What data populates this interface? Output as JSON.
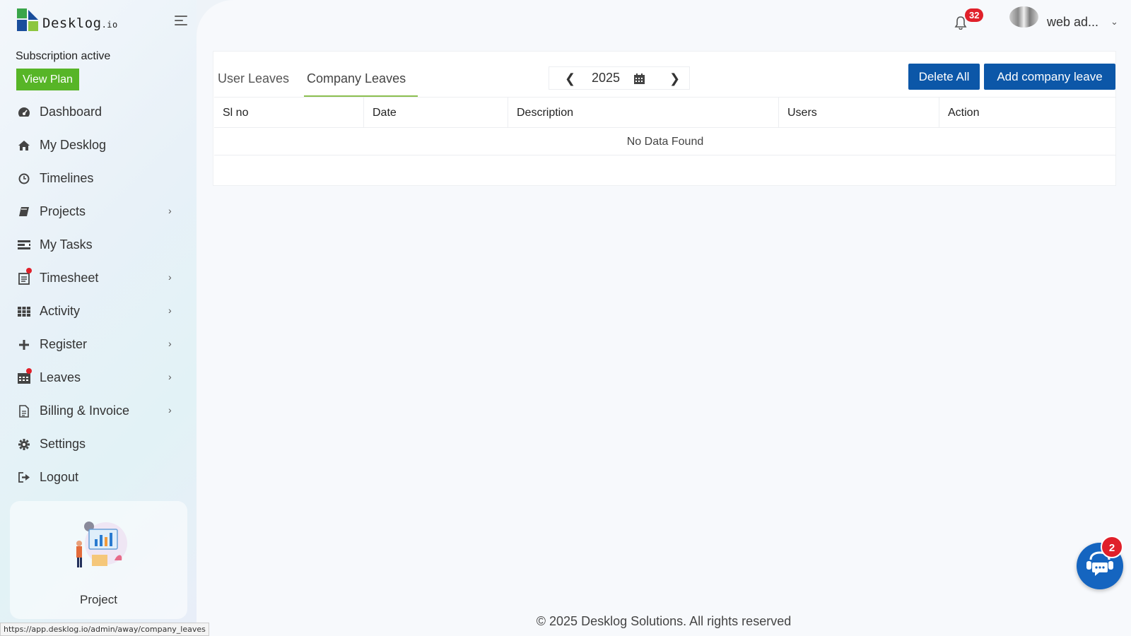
{
  "brand": {
    "name": "Desklog",
    "suffix": ".io"
  },
  "subscription": {
    "status": "Subscription active",
    "view_plan_label": "View Plan"
  },
  "nav": [
    {
      "label": "Dashboard",
      "icon": "dashboard-icon",
      "has_submenu": false
    },
    {
      "label": "My Desklog",
      "icon": "home-icon",
      "has_submenu": false
    },
    {
      "label": "Timelines",
      "icon": "clock-icon",
      "has_submenu": false
    },
    {
      "label": "Projects",
      "icon": "book-icon",
      "has_submenu": true
    },
    {
      "label": "My Tasks",
      "icon": "tasks-icon",
      "has_submenu": false
    },
    {
      "label": "Timesheet",
      "icon": "timesheet-icon",
      "has_submenu": true
    },
    {
      "label": "Activity",
      "icon": "grid-icon",
      "has_submenu": true
    },
    {
      "label": "Register",
      "icon": "plus-icon",
      "has_submenu": true
    },
    {
      "label": "Leaves",
      "icon": "calendar-icon",
      "has_submenu": true
    },
    {
      "label": "Billing & Invoice",
      "icon": "document-icon",
      "has_submenu": true
    },
    {
      "label": "Settings",
      "icon": "gear-icon",
      "has_submenu": false
    },
    {
      "label": "Logout",
      "icon": "logout-icon",
      "has_submenu": false
    }
  ],
  "promo": {
    "label": "Project"
  },
  "header": {
    "notification_count": "32",
    "user_name": "web ad..."
  },
  "tabs": {
    "user_leaves": "User Leaves",
    "company_leaves": "Company Leaves"
  },
  "year_picker": {
    "year": "2025"
  },
  "actions": {
    "delete_all": "Delete All",
    "add_company_leave": "Add company leave"
  },
  "table": {
    "headers": [
      "Sl no",
      "Date",
      "Description",
      "Users",
      "Action"
    ],
    "empty_message": "No Data Found"
  },
  "footer": {
    "text": "© 2025 Desklog Solutions. All rights reserved"
  },
  "chat": {
    "badge_count": "2"
  },
  "status_bar": {
    "url": "https://app.desklog.io/admin/away/company_leaves"
  },
  "colors": {
    "primary_button": "#0c57a8",
    "view_plan": "#57b527",
    "badge": "#e0202a",
    "tab_underline": "#8cbf4f"
  }
}
